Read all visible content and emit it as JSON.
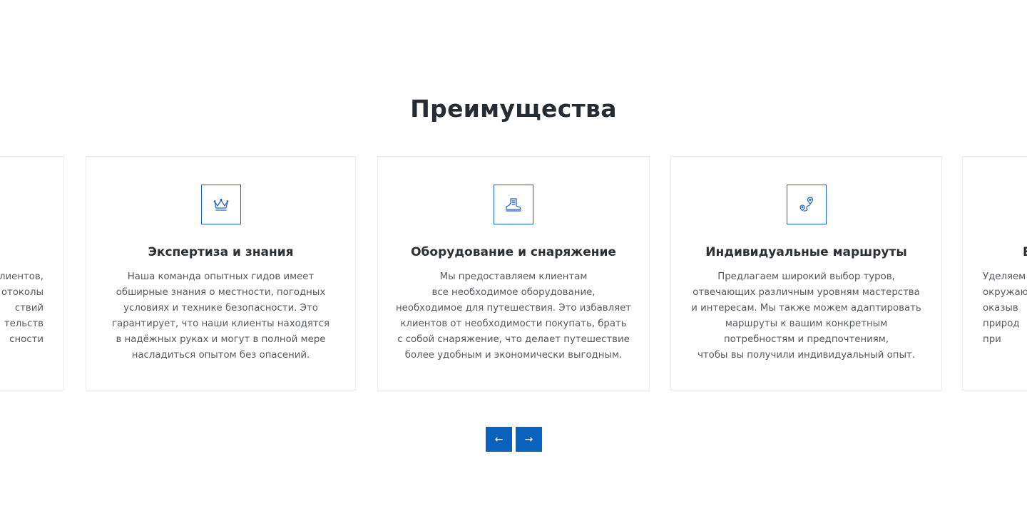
{
  "section": {
    "title": "Преимущества"
  },
  "colors": {
    "accent": "#0b62bd",
    "icon_stroke": "#1a64c6",
    "title_text": "#262c33",
    "body_text": "#555a60",
    "card_border": "#ececec"
  },
  "cards": [
    {
      "title": "",
      "icon": "",
      "text": "лиентов,\nотоколы\nствий\nтельств\nсности"
    },
    {
      "title": "Экспертиза и знания",
      "icon": "crown-icon",
      "text": "Наша команда опытных гидов имеет\nобширные знания о местности, погодных\nусловиях и технике безопасности. Это\nгарантирует, что наши клиенты находятся\nв надёжных руках и могут в полной мере\nнасладиться опытом без опасений."
    },
    {
      "title": "Оборудование и снаряжение",
      "icon": "hiking-boot-icon",
      "text": "Мы предоставляем клиентам\nвсе необходимое оборудование,\nнеобходимое для путешествия. Это избавляет\nклиентов от необходимости покупать, брать\nс собой снаряжение, что делает путешествие\nболее удобным и экономически выгодным."
    },
    {
      "title": "Индивидуальные маршруты",
      "icon": "route-pins-icon",
      "text": "Предлагаем широкий выбор туров,\nотвечающих различным уровням мастерства\nи интересам. Мы также можем адаптировать\nмаршруты к вашим конкретным\nпотребностям и предпочтениям,\nчтобы вы получили индивидуальный опыт."
    },
    {
      "title": "Б",
      "icon": "",
      "text": "Уделяем\nокружаю\nоказыв\nприрод\nпри"
    }
  ],
  "navigation": {
    "prev_label": "←",
    "next_label": "→"
  }
}
